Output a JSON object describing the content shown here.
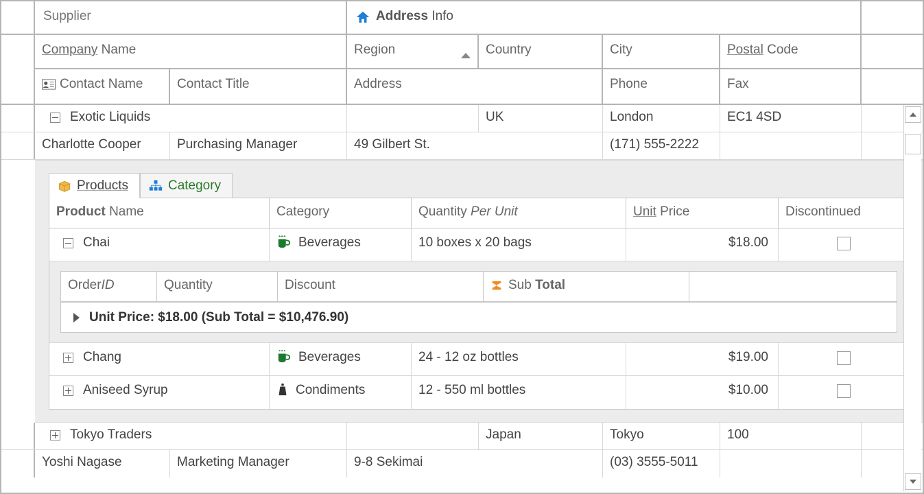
{
  "bands": {
    "supplier": "Supplier",
    "address_bold": "Address",
    "address_rest": "Info"
  },
  "headers": {
    "company_u": "Company",
    "company_rest": "Name",
    "region": "Region",
    "country": "Country",
    "city": "City",
    "postal_u": "Postal",
    "postal_rest": "Code",
    "contact_name": "Contact Name",
    "contact_title": "Contact Title",
    "address": "Address",
    "phone": "Phone",
    "fax": "Fax"
  },
  "suppliers": [
    {
      "company": "Exotic Liquids",
      "region": "",
      "country": "UK",
      "city": "London",
      "postal": "EC1 4SD",
      "contact_name": "Charlotte Cooper",
      "contact_title": "Purchasing Manager",
      "address": "49 Gilbert St.",
      "phone": "(171) 555-2222",
      "fax": ""
    },
    {
      "company": "Tokyo Traders",
      "region": "",
      "country": "Japan",
      "city": "Tokyo",
      "postal": "100",
      "contact_name": "Yoshi Nagase",
      "contact_title": "Marketing Manager",
      "address": "9-8 Sekimai",
      "phone": "(03) 3555-5011",
      "fax": ""
    }
  ],
  "tabs": {
    "products": "Products",
    "category": "Category"
  },
  "product_headers": {
    "name_b": "Product",
    "name_rest": "Name",
    "category": "Category",
    "qty_label": "Quantity",
    "qty_i": "Per Unit",
    "price_u": "Unit",
    "price_rest": "Price",
    "discontinued": "Discontinued"
  },
  "products": [
    {
      "name": "Chai",
      "category": "Beverages",
      "qty": "10 boxes x 20 bags",
      "price": "$18.00"
    },
    {
      "name": "Chang",
      "category": "Beverages",
      "qty": "24 - 12 oz bottles",
      "price": "$19.00"
    },
    {
      "name": "Aniseed Syrup",
      "category": "Condiments",
      "qty": "12 - 550 ml bottles",
      "price": "$10.00"
    }
  ],
  "order_headers": {
    "order": "Order",
    "id_i": "ID",
    "quantity": "Quantity",
    "discount": "Discount",
    "sub": "Sub",
    "total_b": "Total"
  },
  "group_row": "Unit Price: $18.00 (Sub Total = $10,476.90)"
}
